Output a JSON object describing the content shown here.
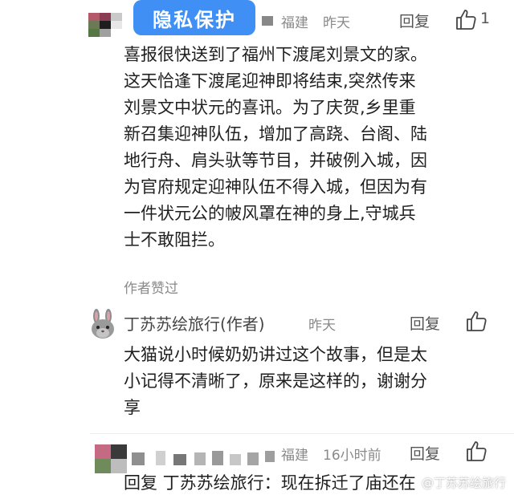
{
  "privacy_badge": "隐私保护",
  "comments": [
    {
      "location": "福建",
      "time": "昨天",
      "reply_label": "回复",
      "like_count": "1",
      "text_lines": [
        "喜报很快送到了福州下渡尾刘景文的家。",
        "这天恰逢下渡尾迎神即将结束,突然传来",
        "刘景文中状元的喜讯。为了庆贺,乡里重",
        "新召集迎神队伍，增加了高跷、台阁、陆",
        "地行舟、肩头驮等节目，并破例入城，因",
        "为官府规定迎神队伍不得入城，但因为有",
        "一件状元公的帔风罩在神的身上,守城兵",
        "士不敢阻拦。"
      ],
      "liked_by_author": "作者赞过"
    },
    {
      "author": "丁苏苏绘旅行(作者)",
      "time": "昨天",
      "reply_label": "回复",
      "text_lines": [
        "大猫说小时候奶奶讲过这个故事，但是太",
        "小记得不清晰了，原来是这样的，谢谢分",
        "享"
      ]
    },
    {
      "location": "福建",
      "time": "16小时前",
      "reply_label": "回复",
      "text": "回复 丁苏苏绘旅行：现在拆迁了庙还在"
    }
  ],
  "watermark": "@丁苏苏绘旅行"
}
